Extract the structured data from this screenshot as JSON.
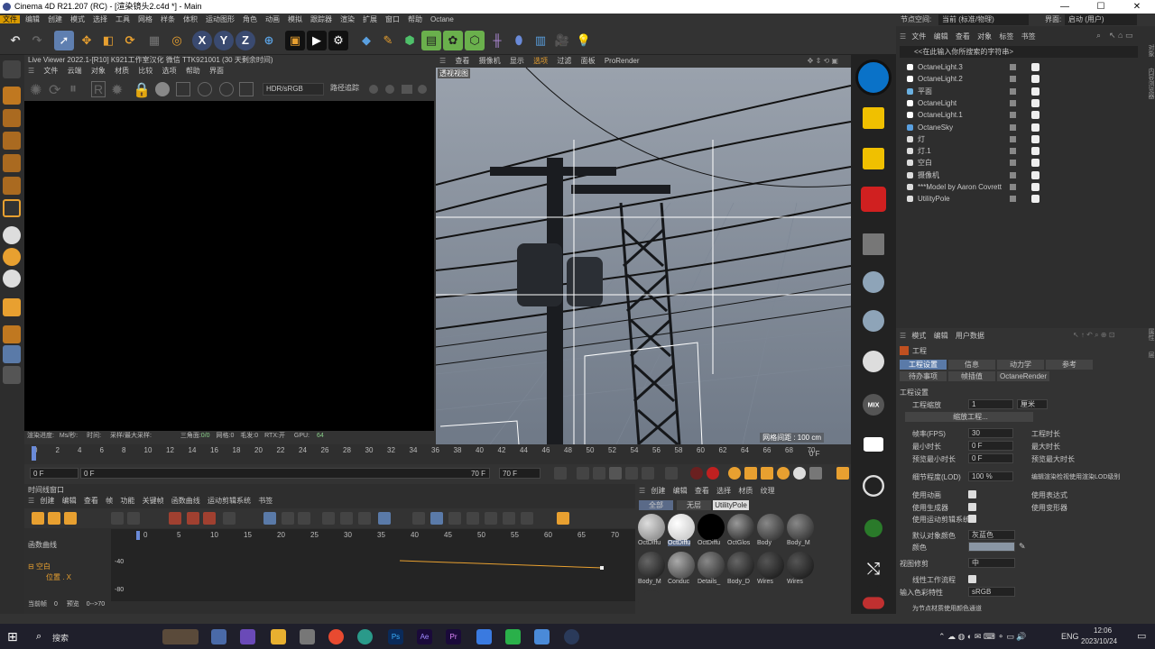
{
  "window": {
    "title": "Cinema 4D R21.207 (RC) - [渲染镜头2.c4d *] - Main",
    "minimize": "—",
    "maximize": "☐",
    "close": "✕"
  },
  "menubar": {
    "items": [
      "文件",
      "编辑",
      "创建",
      "模式",
      "选择",
      "工具",
      "网格",
      "样条",
      "体积",
      "运动图形",
      "角色",
      "动画",
      "模拟",
      "跟踪器",
      "渲染",
      "扩展",
      "窗口",
      "帮助",
      "Octane"
    ],
    "node_space_label": "节点空间:",
    "node_space_value": "当前 (标准/物理)",
    "interface_label": "界面:",
    "interface_value": "启动 (用户)"
  },
  "toolbar": {
    "axis_x": "X",
    "axis_y": "Y",
    "axis_z": "Z"
  },
  "live_viewer": {
    "title": "Live Viewer 2022.1-[R10]  K921工作室汉化 微信 TTK921001 (30 天剩余时间)",
    "menu": [
      "文件",
      "云端",
      "对象",
      "材质",
      "比较",
      "选项",
      "帮助",
      "界面"
    ],
    "color_mode": "HDR/sRGB",
    "trace_mode": "路径追踪",
    "status": {
      "progress_label": "渲染进度:",
      "ms_label": "Ms/秒:",
      "time_label": "时间:",
      "spp_label": "采样/最大采样:",
      "tri_label": "三角面:",
      "tri_value": "0/0",
      "mesh_label": "网格:",
      "mesh_value": "0",
      "hair_label": "毛发:",
      "hair_value": "0",
      "rtx_label": "RTX:",
      "rtx_value": "开",
      "gpu_label": "GPU:",
      "gpu_value": "64"
    }
  },
  "viewport": {
    "menu": [
      "查看",
      "摄像机",
      "显示",
      "选项",
      "过滤",
      "面板",
      "ProRender"
    ],
    "label": "透视视图",
    "grid_info": "网格间距 : 100 cm"
  },
  "timeline": {
    "ticks": [
      "0",
      "2",
      "4",
      "6",
      "8",
      "10",
      "12",
      "14",
      "16",
      "18",
      "20",
      "22",
      "24",
      "26",
      "28",
      "30",
      "32",
      "34",
      "36",
      "38",
      "40",
      "42",
      "44",
      "46",
      "48",
      "50",
      "52",
      "54",
      "56",
      "58",
      "60",
      "62",
      "64",
      "66",
      "68",
      "70"
    ],
    "end_frame_label": "0 F",
    "start_field": "0 F",
    "current_field": "0 F",
    "end_field": "70 F",
    "end_field2": "70 F"
  },
  "timeline_window": {
    "title": "时间线窗口",
    "menu": [
      "创建",
      "编辑",
      "查看",
      "帧",
      "功能",
      "关键帧",
      "函数曲线",
      "运动剪辑系统",
      "书签"
    ],
    "curve_label": "函数曲线",
    "ticks": [
      "0",
      "5",
      "10",
      "15",
      "20",
      "25",
      "30",
      "35",
      "40",
      "45",
      "50",
      "55",
      "60",
      "65",
      "70"
    ],
    "track_object": "空白",
    "track_param": "位置 . X",
    "value_minus40": "-40",
    "value_minus80": "-80",
    "current_frame_label": "当前帧",
    "current_frame_value": "0",
    "preview_label": "预览",
    "preview_value": "0-->70"
  },
  "materials": {
    "menu": [
      "创建",
      "编辑",
      "查看",
      "选择",
      "材质",
      "纹理"
    ],
    "tabs": [
      "全部",
      "无层",
      "UtilityPole"
    ],
    "items": [
      "OctDiffu",
      "OctDiffu",
      "OctDiffu",
      "OctGlos",
      "Body",
      "Body_M",
      "Body_M",
      "Conduc",
      "Details_",
      "Body_D",
      "Wires",
      "Wires"
    ]
  },
  "objects": {
    "menu": [
      "文件",
      "编辑",
      "查看",
      "对象",
      "标签",
      "书签"
    ],
    "search_placeholder": "<<在此输入你所搜索的字符串>",
    "rows": [
      {
        "name": "OctaneLight.3"
      },
      {
        "name": "OctaneLight.2"
      },
      {
        "name": "平面"
      },
      {
        "name": "OctaneLight"
      },
      {
        "name": "OctaneLight.1"
      },
      {
        "name": "OctaneSky"
      },
      {
        "name": "灯"
      },
      {
        "name": "灯.1"
      },
      {
        "name": "空白"
      },
      {
        "name": "摄像机"
      },
      {
        "name": "***Model by Aaron Covrett"
      },
      {
        "name": "UtilityPole"
      }
    ],
    "side_tabs": [
      "对象",
      "内容浏览器"
    ]
  },
  "attributes": {
    "menu": [
      "模式",
      "编辑",
      "用户数据"
    ],
    "title": "工程",
    "tabs_row1": [
      "工程设置",
      "信息",
      "动力学",
      "参考"
    ],
    "tabs_row2": [
      "待办事项",
      "帧插值",
      "OctaneRender"
    ],
    "section": "工程设置",
    "scale_label": "工程缩放",
    "scale_value": "1",
    "scale_unit": "厘米",
    "scale_button": "缩放工程...",
    "fps_label": "帧率(FPS)",
    "fps_value": "30",
    "min_time_label": "最小时长",
    "min_time_value": "0 F",
    "preview_min_label": "预览最小时长",
    "preview_min_value": "0 F",
    "project_time_label": "工程时长",
    "max_time_label": "最大时长",
    "preview_max_label": "预览最大时长",
    "lod_label": "细节程度(LOD)",
    "lod_value": "100 %",
    "lod_render_label": "编辑渲染检视使用渲染LOD级别",
    "use_anim_label": "使用动画",
    "use_expr_label": "使用表达式",
    "use_gen_label": "使用生成器",
    "use_deform_label": "使用变形器",
    "use_motion_label": "使用运动剪辑系统",
    "default_color_label": "默认对象颜色",
    "default_color_value": "灰蓝色",
    "color_label": "颜色",
    "view_clip_label": "视图修剪",
    "view_clip_value": "中",
    "linear_label": "线性工作流程",
    "input_color_label": "输入色彩特性",
    "input_color_value": "sRGB",
    "node_color_label": "为节点材质使用颜色通道",
    "side_tabs": [
      "属性",
      "层"
    ]
  },
  "taskbar": {
    "search_label": "搜索",
    "lang": "ENG",
    "time": "12:06",
    "date": "2023/10/24"
  }
}
